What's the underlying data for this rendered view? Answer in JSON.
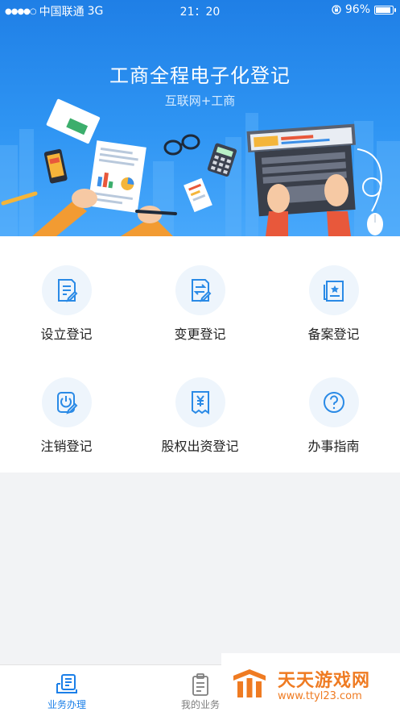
{
  "status_bar": {
    "signal": "●●●●○",
    "carrier": "中国联通",
    "network": "3G",
    "time": "21：20",
    "battery_percent": "96%",
    "battery_level": 0.96,
    "icons": [
      "signal-icon",
      "orientation-lock-icon",
      "battery-icon"
    ]
  },
  "hero": {
    "title": "工商全程电子化登记",
    "subtitle": "互联网+工商"
  },
  "services": [
    {
      "label": "设立登记",
      "icon": "document-edit-icon"
    },
    {
      "label": "变更登记",
      "icon": "document-change-icon"
    },
    {
      "label": "备案登记",
      "icon": "certificate-icon"
    },
    {
      "label": "注销登记",
      "icon": "power-off-icon"
    },
    {
      "label": "股权出资登记",
      "icon": "receipt-yen-icon"
    },
    {
      "label": "办事指南",
      "icon": "question-icon"
    }
  ],
  "tabbar": {
    "tabs": [
      {
        "label": "业务办理",
        "icon": "business-icon",
        "active": true
      },
      {
        "label": "我的业务",
        "icon": "clipboard-icon",
        "active": false
      }
    ]
  },
  "watermark": {
    "title": "天天游戏网",
    "url": "www.ttyl23.com"
  },
  "colors": {
    "accent": "#1b7fe8",
    "hero_top": "#1f7fe6",
    "watermark": "#ef7b22",
    "icon_bg": "#eef5fc"
  }
}
